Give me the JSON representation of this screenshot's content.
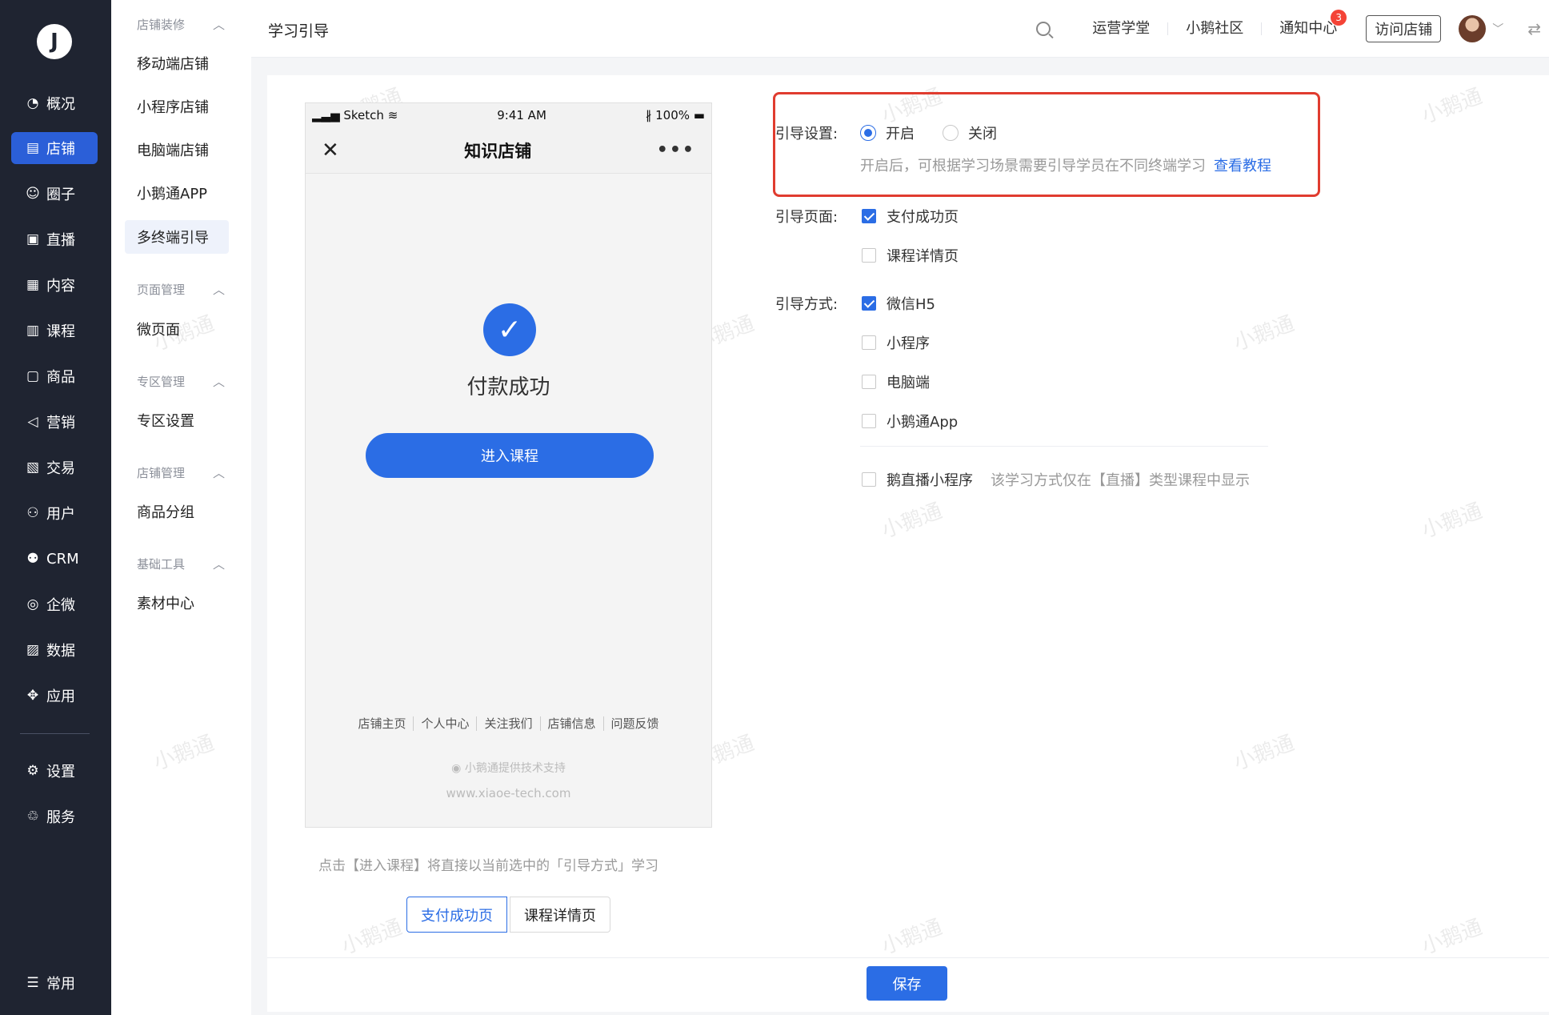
{
  "logo_glyph": "J",
  "main_nav": [
    {
      "icon": "chart-pie-icon",
      "glyph": "◔",
      "label": "概况"
    },
    {
      "icon": "store-icon",
      "glyph": "▤",
      "label": "店铺",
      "active": true
    },
    {
      "icon": "community-icon",
      "glyph": "☺",
      "label": "圈子"
    },
    {
      "icon": "live-icon",
      "glyph": "▣",
      "label": "直播"
    },
    {
      "icon": "content-icon",
      "glyph": "▦",
      "label": "内容"
    },
    {
      "icon": "course-icon",
      "glyph": "▥",
      "label": "课程"
    },
    {
      "icon": "goods-icon",
      "glyph": "▢",
      "label": "商品"
    },
    {
      "icon": "marketing-icon",
      "glyph": "◁",
      "label": "营销"
    },
    {
      "icon": "trade-icon",
      "glyph": "▧",
      "label": "交易"
    },
    {
      "icon": "user-icon",
      "glyph": "⚇",
      "label": "用户"
    },
    {
      "icon": "crm-icon",
      "glyph": "⚉",
      "label": "CRM"
    },
    {
      "icon": "wecom-icon",
      "glyph": "◎",
      "label": "企微"
    },
    {
      "icon": "data-icon",
      "glyph": "▨",
      "label": "数据"
    },
    {
      "icon": "apps-icon",
      "glyph": "✥",
      "label": "应用"
    },
    {
      "icon": "settings-icon",
      "glyph": "⚙",
      "label": "设置"
    },
    {
      "icon": "service-icon",
      "glyph": "♲",
      "label": "服务"
    },
    {
      "icon": "common-icon",
      "glyph": "☰",
      "label": "常用"
    }
  ],
  "sub_nav": {
    "groups": [
      {
        "title": "店铺装修",
        "items": [
          "移动端店铺",
          "小程序店铺",
          "电脑端店铺",
          "小鹅通APP",
          "多终端引导"
        ]
      },
      {
        "title": "页面管理",
        "items": [
          "微页面"
        ]
      },
      {
        "title": "专区管理",
        "items": [
          "专区设置"
        ]
      },
      {
        "title": "店铺管理",
        "items": [
          "商品分组"
        ]
      },
      {
        "title": "基础工具",
        "items": [
          "素材中心"
        ]
      }
    ],
    "active_item": "多终端引导"
  },
  "header": {
    "title": "学习引导",
    "links": [
      "运营学堂",
      "小鹅社区",
      "通知中心"
    ],
    "notification_count": "3",
    "visit_button": "访问店铺"
  },
  "phone": {
    "carrier": "Sketch",
    "time": "9:41 AM",
    "battery": "100%",
    "page_title": "知识店铺",
    "success_text": "付款成功",
    "enter_button": "进入课程",
    "footer_links": [
      "店铺主页",
      "个人中心",
      "关注我们",
      "店铺信息",
      "问题反馈"
    ],
    "support_text": "小鹅通提供技术支持",
    "url": "www.xiaoe-tech.com"
  },
  "preview_hint": "点击【进入课程】将直接以当前选中的「引导方式」学习",
  "preview_tabs": [
    "支付成功页",
    "课程详情页"
  ],
  "settings": {
    "guide_label": "引导设置:",
    "radio_on": "开启",
    "radio_off": "关闭",
    "guide_desc": "开启后，可根据学习场景需要引导学员在不同终端学习",
    "tutorial_link": "查看教程",
    "pages_label": "引导页面:",
    "pages": [
      {
        "label": "支付成功页",
        "checked": true
      },
      {
        "label": "课程详情页",
        "checked": false
      }
    ],
    "method_label": "引导方式:",
    "methods": [
      {
        "label": "微信H5",
        "checked": true
      },
      {
        "label": "小程序",
        "checked": false
      },
      {
        "label": "电脑端",
        "checked": false
      },
      {
        "label": "小鹅通App",
        "checked": false
      }
    ],
    "extra_method": {
      "label": "鹅直播小程序",
      "checked": false,
      "note": "该学习方式仅在【直播】类型课程中显示"
    }
  },
  "save_button": "保存",
  "watermark": "小鹅通",
  "colors": {
    "primary": "#2b6de5",
    "nav_bg": "#1f2431",
    "highlight": "#e03c2f"
  }
}
